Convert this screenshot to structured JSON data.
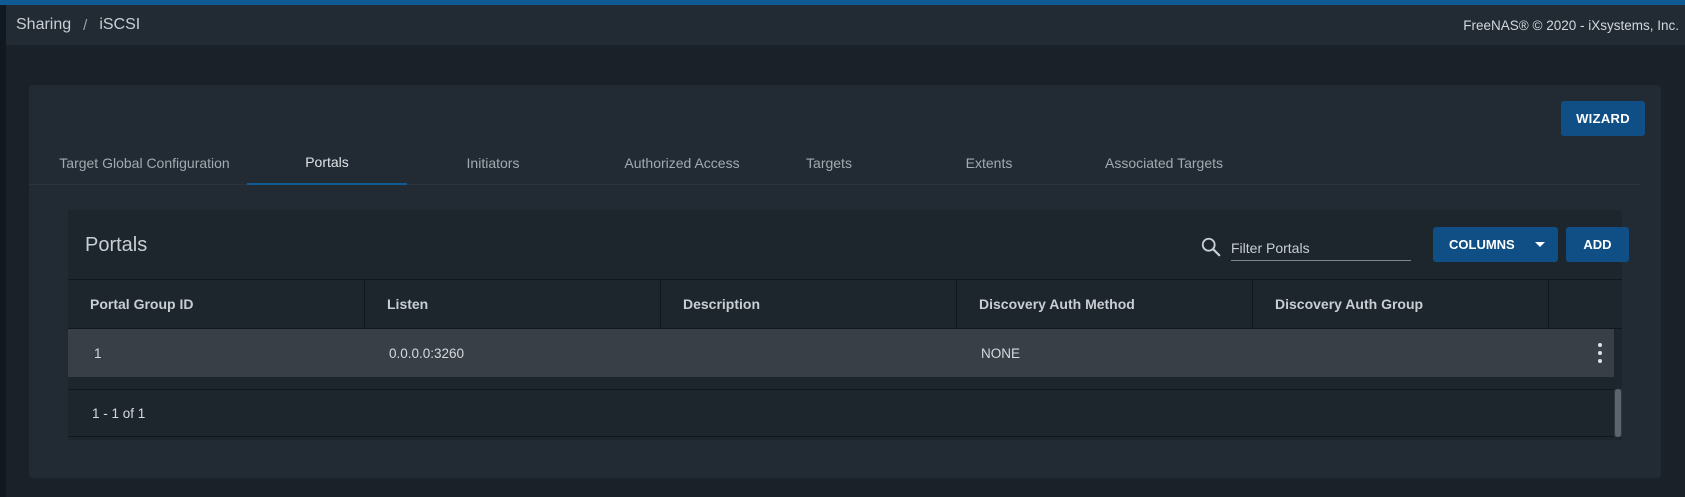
{
  "breadcrumb": {
    "parent": "Sharing",
    "separator": "/",
    "current": "iSCSI"
  },
  "copyright": "FreeNAS® © 2020 - iXsystems, Inc.",
  "wizard_label": "WIZARD",
  "tabs": [
    {
      "label": "Target Global Configuration",
      "active": false
    },
    {
      "label": "Portals",
      "active": true
    },
    {
      "label": "Initiators",
      "active": false
    },
    {
      "label": "Authorized Access",
      "active": false
    },
    {
      "label": "Targets",
      "active": false
    },
    {
      "label": "Extents",
      "active": false
    },
    {
      "label": "Associated Targets",
      "active": false
    }
  ],
  "table": {
    "title": "Portals",
    "search_icon": "search-icon",
    "filter_placeholder": "Filter Portals",
    "columns_label": "COLUMNS",
    "add_label": "ADD",
    "headers": [
      "Portal Group ID",
      "Listen",
      "Description",
      "Discovery Auth Method",
      "Discovery Auth Group"
    ],
    "rows": [
      {
        "portal_group_id": "1",
        "listen": "0.0.0.0:3260",
        "description": "",
        "discovery_auth_method": "NONE",
        "discovery_auth_group": ""
      }
    ],
    "row_menu_icon": "more-vert-icon",
    "pagination": "1 - 1 of 1"
  },
  "colors": {
    "accent": "#0f5a93",
    "button": "#0f4f85",
    "background": "#1a2129",
    "card": "#222b34",
    "row_highlight": "#383f46"
  }
}
